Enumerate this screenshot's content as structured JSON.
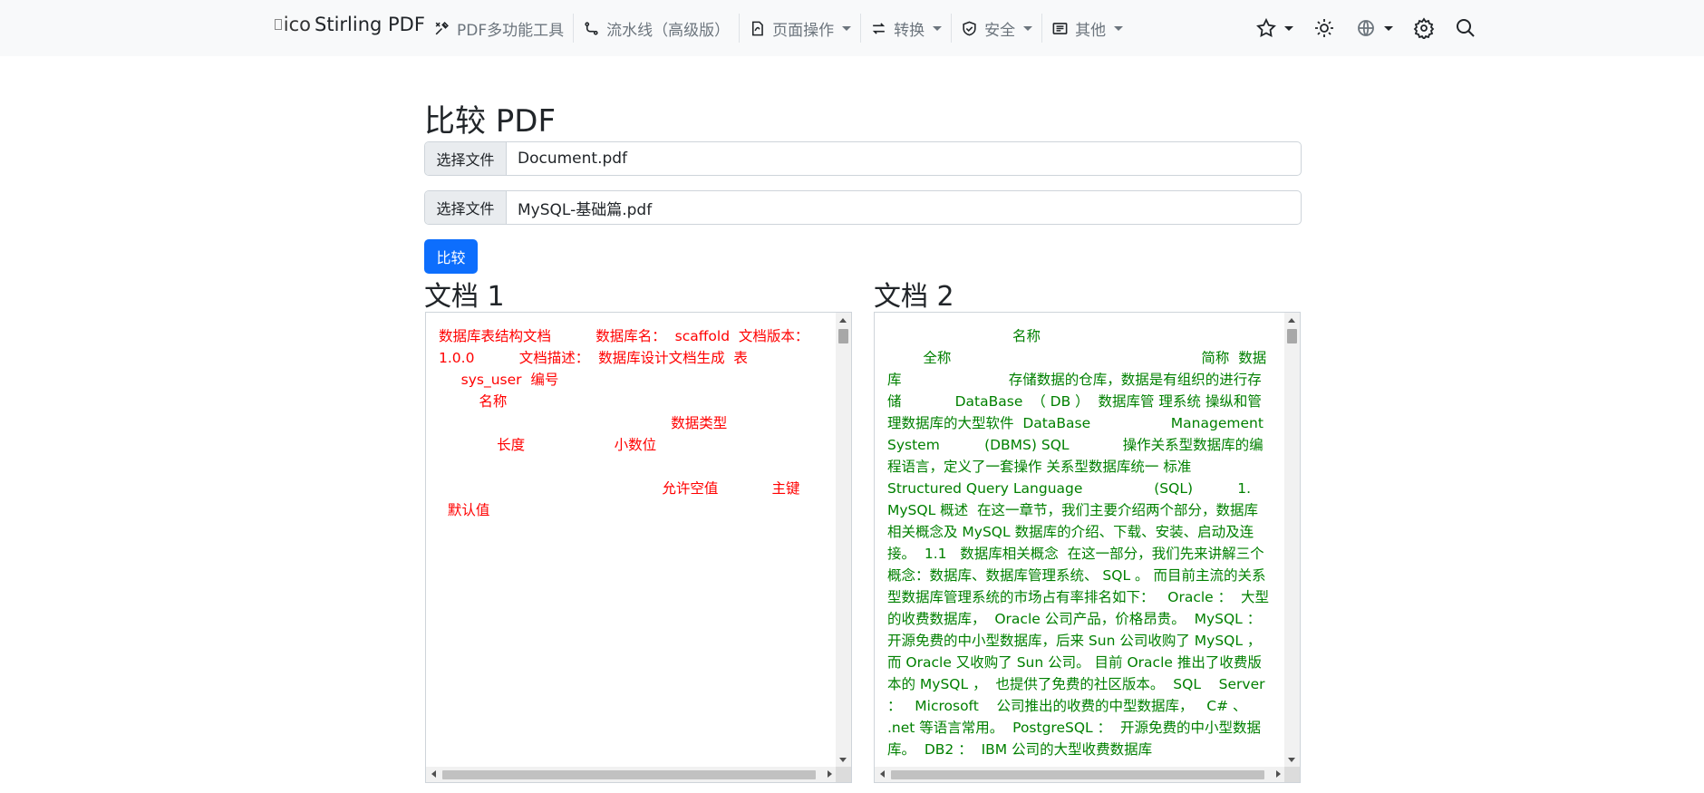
{
  "navbar": {
    "brand_text": "Stirling PDF",
    "broken_img_alt": "ico",
    "items": [
      {
        "label": "PDF多功能工具",
        "icon": "tools-icon"
      },
      {
        "label": "流水线（高级版）",
        "icon": "pipeline-icon"
      },
      {
        "label": "页面操作",
        "icon": "file-pdf-icon"
      },
      {
        "label": "转换",
        "icon": "arrows-exchange-icon"
      },
      {
        "label": "安全",
        "icon": "shield-check-icon"
      },
      {
        "label": "其他",
        "icon": "list-card-icon"
      }
    ],
    "right_icons": [
      "star-icon",
      "sun-icon",
      "globe-icon",
      "gear-icon",
      "search-icon"
    ]
  },
  "page": {
    "title": "比较 PDF",
    "file1": {
      "button": "选择文件",
      "name": "Document.pdf"
    },
    "file2": {
      "button": "选择文件",
      "name": "MySQL-基础篇.pdf"
    },
    "compare_label": "比较",
    "doc1_title": "文档 1",
    "doc2_title": "文档 2",
    "doc1_text": "数据库表结构文档          数据库名：  scaffold  文档版本：  1.0.0          文档描述：  数据库设计文档生成  表\n     sys_user  编号\n         名称\n                                                    数据类型\n             长度                    小数位\n\n                                                  允许空值            主键\n  默认值",
    "doc2_text": "                            名称\n        全称                                                        简称  数据库                        存储数据的仓库，数据是有组织的进行存储            DataBase  （ DB ）  数据库管 理系统 操纵和管理数据库的大型软件  DataBase                  Management  System          (DBMS) SQL            操作关系型数据库的编程语言，定义了一套操作 关系型数据库统一 标准  Structured Query Language                (SQL)          1.          MySQL 概述  在这一章节，我们主要介绍两个部分，数据库相关概念及 MySQL 数据库的介绍、下载、安装、启动及连 接。  1.1   数据库相关概念  在这一部分，我们先来讲解三个概念：数据库、数据库管理系统、 SQL 。 而目前主流的关系型数据库管理系统的市场占有率排名如下：   Oracle ：  大型的收费数据库，  Oracle 公司产品，价格昂贵。  MySQL ：  开源免费的中小型数据库，后来 Sun 公司收购了 MySQL ，  而 Oracle 又收购了 Sun 公司。 目前 Oracle 推出了收费版本的 MySQL ，  也提供了免费的社区版本。  SQL    Server ：   Microsoft    公司推出的收费的中型数据库，   C# 、 .net 等语言常用。  PostgreSQL ：  开源免费的中小型数据库。  DB2 ：  IBM 公司的大型收费数据库"
  }
}
